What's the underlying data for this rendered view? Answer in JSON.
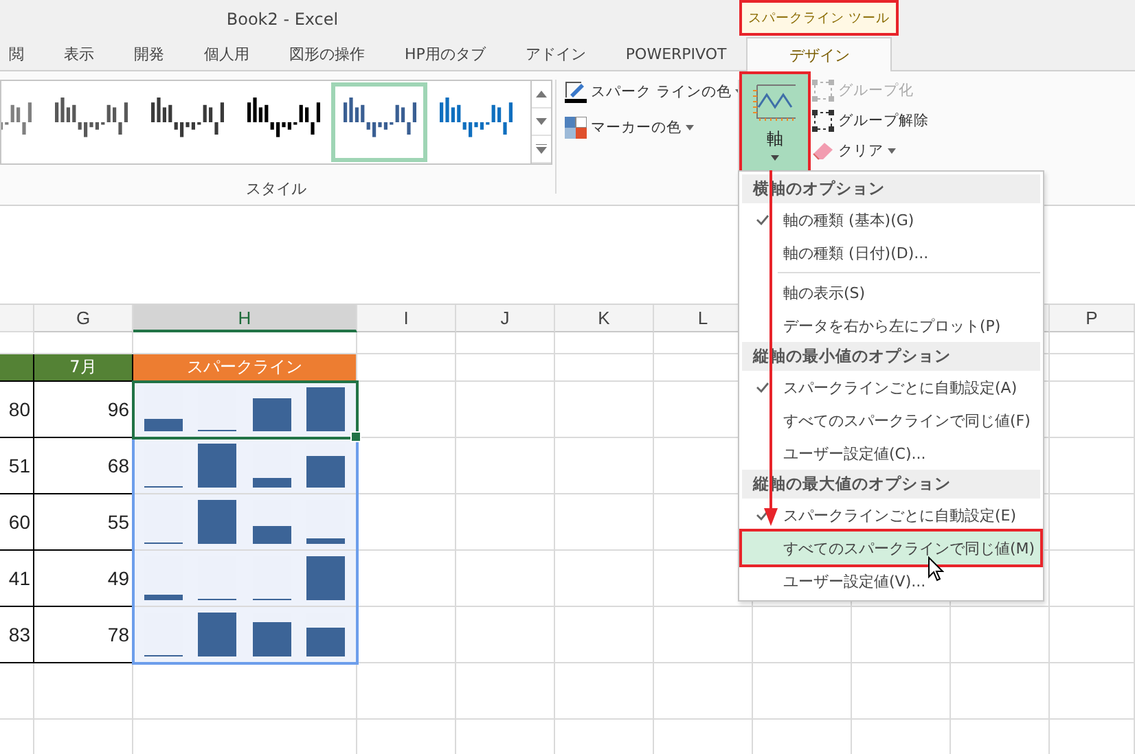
{
  "window": {
    "title": "Book2 - Excel"
  },
  "context_tab": {
    "label": "スパークライン ツール",
    "annotated": true
  },
  "tabs": [
    {
      "label": "閲",
      "selected": false
    },
    {
      "label": "表示",
      "selected": false
    },
    {
      "label": "開発",
      "selected": false
    },
    {
      "label": "個人用",
      "selected": false
    },
    {
      "label": "図形の操作",
      "selected": false
    },
    {
      "label": "HP用のタブ",
      "selected": false
    },
    {
      "label": "アドイン",
      "selected": false
    },
    {
      "label": "POWERPIVOT",
      "selected": false
    },
    {
      "label": "デザイン",
      "selected": true
    }
  ],
  "style_gallery": {
    "label": "スタイル",
    "items": [
      {
        "color": "#808080",
        "selected": false
      },
      {
        "color": "#595959",
        "selected": false
      },
      {
        "color": "#3a3a3a",
        "selected": false
      },
      {
        "color": "#000000",
        "selected": false
      },
      {
        "color": "#3a5f93",
        "selected": true
      },
      {
        "color": "#0e6fbf",
        "selected": false
      }
    ]
  },
  "color_buttons": [
    {
      "kind": "sparkline_color",
      "label": "スパーク ラインの色"
    },
    {
      "kind": "marker_color",
      "label": "マーカーの色"
    }
  ],
  "axis_button": {
    "label": "軸",
    "annotated": true
  },
  "group_buttons": [
    {
      "kind": "group",
      "label": "グループ化",
      "disabled": true
    },
    {
      "kind": "ungroup",
      "label": "グループ解除",
      "disabled": false
    },
    {
      "kind": "clear",
      "label": "クリア",
      "disabled": false
    }
  ],
  "sheet": {
    "columns": [
      {
        "label": "G",
        "selected": false
      },
      {
        "label": "H",
        "selected": true
      },
      {
        "label": "I",
        "selected": false
      },
      {
        "label": "J",
        "selected": false
      },
      {
        "label": "K",
        "selected": false
      },
      {
        "label": "L",
        "selected": false
      }
    ],
    "columns_right": [
      {
        "label": "P",
        "selected": false
      }
    ],
    "header": {
      "g": "7月",
      "h": "スパークライン"
    },
    "rows": [
      {
        "f": "80",
        "g": "96",
        "active": true,
        "bars": [
          {
            "level": 0.27
          },
          {
            "level": 0
          },
          {
            "level": 0.76
          },
          {
            "level": 1
          }
        ]
      },
      {
        "f": "51",
        "g": "68",
        "active": false,
        "bars": [
          {
            "level": 0
          },
          {
            "level": 1
          },
          {
            "level": 0.22
          },
          {
            "level": 0.72
          }
        ]
      },
      {
        "f": "60",
        "g": "55",
        "active": false,
        "bars": [
          {
            "level": 0
          },
          {
            "level": 1
          },
          {
            "level": 0.4
          },
          {
            "level": 0.13
          }
        ]
      },
      {
        "f": "41",
        "g": "49",
        "active": false,
        "bars": [
          {
            "level": 0.12
          },
          {
            "level": 0
          },
          {
            "level": 0
          },
          {
            "level": 1
          }
        ]
      },
      {
        "f": "83",
        "g": "78",
        "active": false,
        "bars": [
          {
            "level": 0
          },
          {
            "level": 1
          },
          {
            "level": 0.78
          },
          {
            "level": 0.65
          }
        ]
      }
    ]
  },
  "menu": [
    {
      "kind": "header",
      "label": "横軸のオプション"
    },
    {
      "kind": "item",
      "label": "軸の種類 (基本)(G)",
      "checked": true,
      "selected": false,
      "annotated": false
    },
    {
      "kind": "item",
      "label": "軸の種類 (日付)(D)...",
      "checked": false,
      "selected": false,
      "annotated": false
    },
    {
      "kind": "separator"
    },
    {
      "kind": "item",
      "label": "軸の表示(S)",
      "checked": false,
      "selected": false,
      "annotated": false
    },
    {
      "kind": "item",
      "label": "データを右から左にプロット(P)",
      "checked": false,
      "selected": false,
      "annotated": false
    },
    {
      "kind": "header",
      "label": "縦軸の最小値のオプション"
    },
    {
      "kind": "item",
      "label": "スパークラインごとに自動設定(A)",
      "checked": true,
      "selected": false,
      "annotated": false
    },
    {
      "kind": "item",
      "label": "すべてのスパークラインで同じ値(F)",
      "checked": false,
      "selected": false,
      "annotated": false
    },
    {
      "kind": "item",
      "label": "ユーザー設定値(C)...",
      "checked": false,
      "selected": false,
      "annotated": false
    },
    {
      "kind": "header",
      "label": "縦軸の最大値のオプション"
    },
    {
      "kind": "item",
      "label": "スパークラインごとに自動設定(E)",
      "checked": true,
      "selected": false,
      "annotated": false
    },
    {
      "kind": "item",
      "label": "すべてのスパークラインで同じ値(M)",
      "checked": false,
      "selected": true,
      "annotated": true
    },
    {
      "kind": "item",
      "label": "ユーザー設定値(V)...",
      "checked": false,
      "selected": false,
      "annotated": false
    }
  ]
}
